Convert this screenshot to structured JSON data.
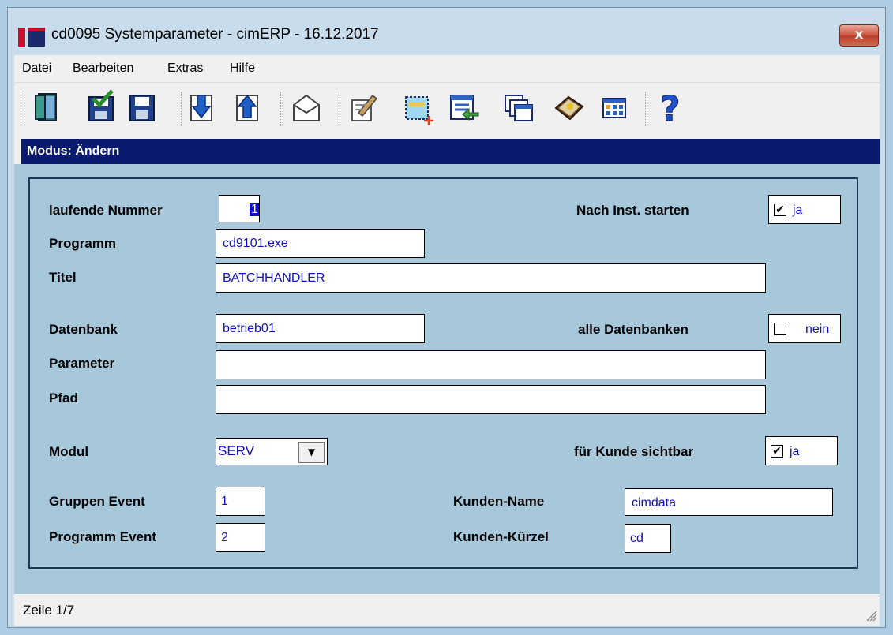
{
  "window": {
    "title": "cd0095 Systemparameter - cimERP - 16.12.2017",
    "close_label": "x"
  },
  "menu": {
    "items": [
      "Datei",
      "Bearbeiten",
      "Extras",
      "Hilfe"
    ]
  },
  "toolbar": {
    "buttons": [
      "exit-door-icon",
      "save-check-icon",
      "save-icon",
      "arrow-down-icon",
      "arrow-up-icon",
      "envelope-icon",
      "notepad-pencil-icon",
      "new-record-icon",
      "transfer-icon",
      "windows-icon",
      "book-icon",
      "grid-icon",
      "help-icon"
    ]
  },
  "mode": {
    "label": "Modus: Ändern"
  },
  "form": {
    "laufende_nummer": {
      "label": "laufende Nummer",
      "value": "1"
    },
    "nach_inst": {
      "label": "Nach Inst. starten",
      "checked": true,
      "text": "ja"
    },
    "programm": {
      "label": "Programm",
      "value": "cd9101.exe"
    },
    "titel": {
      "label": "Titel",
      "value": "BATCHHANDLER"
    },
    "datenbank": {
      "label": "Datenbank",
      "value": "betrieb01"
    },
    "alle_datenbanken": {
      "label": "alle Datenbanken",
      "checked": false,
      "text": "nein"
    },
    "parameter": {
      "label": "Parameter",
      "value": ""
    },
    "pfad": {
      "label": "Pfad",
      "value": ""
    },
    "modul": {
      "label": "Modul",
      "value": "SERV"
    },
    "kunde_sichtbar": {
      "label": "für Kunde sichtbar",
      "checked": true,
      "text": "ja"
    },
    "gruppen_event": {
      "label": "Gruppen Event",
      "value": "1"
    },
    "programm_event": {
      "label": "Programm Event",
      "value": "2"
    },
    "kunden_name": {
      "label": "Kunden-Name",
      "value": "cimdata"
    },
    "kunden_kuerzel": {
      "label": "Kunden-Kürzel",
      "value": "cd"
    }
  },
  "status": {
    "text": "Zeile 1/7"
  }
}
